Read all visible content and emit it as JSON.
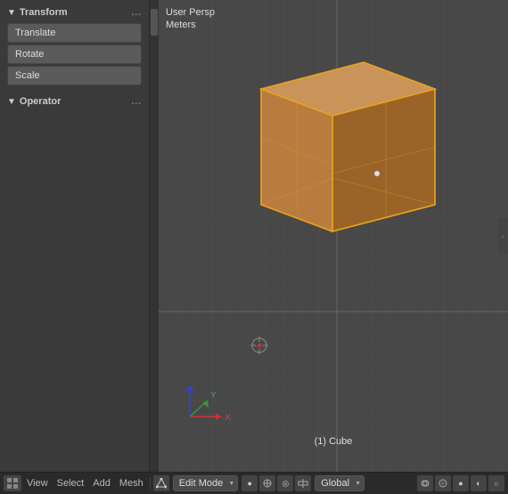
{
  "viewport": {
    "mode": "User Persp",
    "units": "Meters",
    "object_name": "(1) Cube"
  },
  "sidebar": {
    "transform_header": "Transform",
    "transform_dots": "...",
    "operator_header": "Operator",
    "operator_dots": "...",
    "buttons": [
      {
        "label": "Translate",
        "active": false
      },
      {
        "label": "Rotate",
        "active": false
      },
      {
        "label": "Scale",
        "active": false
      }
    ]
  },
  "statusbar": {
    "mode_label": "Edit Mode",
    "global_label": "Global",
    "nav_items": [
      "View",
      "Select",
      "Add",
      "Mesh"
    ],
    "select_label": "Select"
  },
  "colors": {
    "cube_face_front": "#b87c3e",
    "cube_face_top": "#c9945a",
    "cube_face_right": "#9a6428",
    "cube_edge": "#e8a020",
    "grid_line": "#555555",
    "grid_line_center": "#888888",
    "axis_x": "#cc3333",
    "axis_y": "#33aa33",
    "axis_z": "#3333cc"
  }
}
